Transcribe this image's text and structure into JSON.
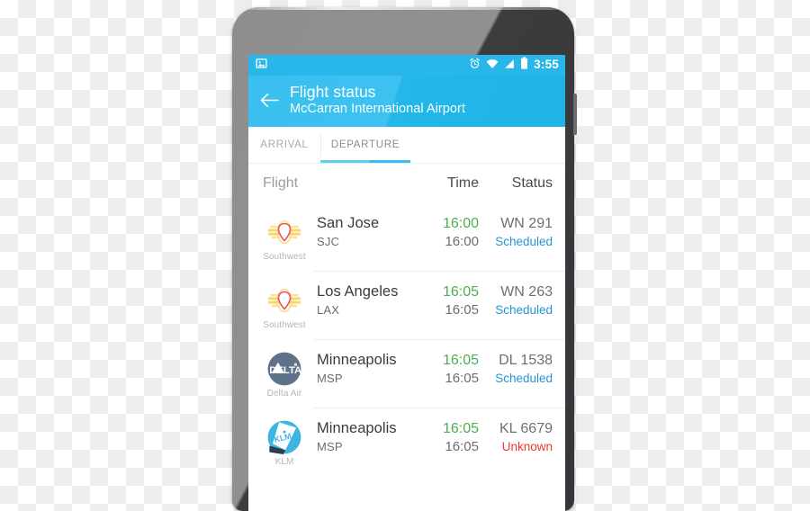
{
  "device": {
    "frame_name": "android-phone",
    "bezel_color": "#3c3c3e"
  },
  "status_bar": {
    "notification_icon": "photo-icon",
    "icons": [
      "alarm-icon",
      "wifi-icon",
      "cellular-signal-icon",
      "battery-icon"
    ],
    "time": "3:55",
    "background": "#29b6e8"
  },
  "toolbar": {
    "back_icon": "back-arrow-icon",
    "title": "Flight status",
    "subtitle": "McCarran International Airport",
    "background": "#2fbcec"
  },
  "tabs": {
    "items": [
      {
        "label": "ARRIVAL",
        "selected": false
      },
      {
        "label": "DEPARTURE",
        "selected": true
      }
    ],
    "indicator_color": "#4cc6f0"
  },
  "columns": {
    "flight": "Flight",
    "time": "Time",
    "status": "Status"
  },
  "flights": [
    {
      "airline": "Southwest",
      "logo": "southwest-heart-logo",
      "city": "San Jose",
      "code": "SJC",
      "time_scheduled": "16:00",
      "time_estimated": "16:00",
      "flight_number": "WN 291",
      "status": "Scheduled",
      "status_color": "#2196d6"
    },
    {
      "airline": "Southwest",
      "logo": "southwest-heart-logo",
      "city": "Los Angeles",
      "code": "LAX",
      "time_scheduled": "16:05",
      "time_estimated": "16:05",
      "flight_number": "WN 263",
      "status": "Scheduled",
      "status_color": "#2196d6"
    },
    {
      "airline": "Delta Air",
      "logo": "delta-logo",
      "city": "Minneapolis",
      "code": "MSP",
      "time_scheduled": "16:05",
      "time_estimated": "16:05",
      "flight_number": "DL 1538",
      "status": "Scheduled",
      "status_color": "#2196d6"
    },
    {
      "airline": "KLM",
      "logo": "klm-logo",
      "city": "Minneapolis",
      "code": "MSP",
      "time_scheduled": "16:05",
      "time_estimated": "16:05",
      "flight_number": "KL 6679",
      "status": "Unknown",
      "status_color": "#f0372c"
    }
  ]
}
